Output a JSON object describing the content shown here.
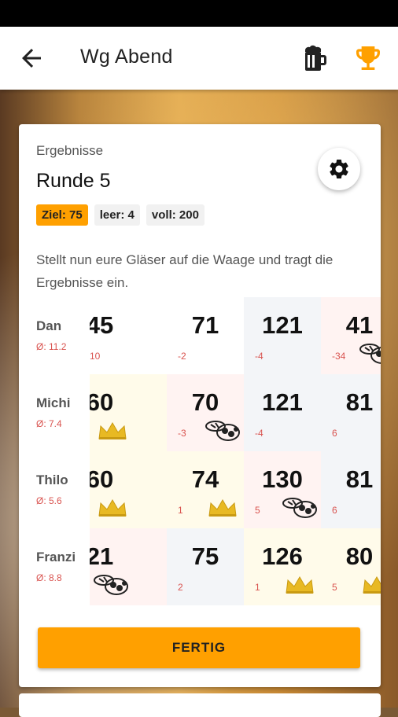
{
  "app": {
    "title": "Wg Abend",
    "icons": {
      "back": "arrow-left-icon",
      "beer": "beer-mug-icon",
      "trophy": "trophy-icon",
      "settings": "gear-icon"
    },
    "colors": {
      "accent": "#ffa000",
      "negative": "#d9534f",
      "underfill_bg": "#fff3f2",
      "exact_bg": "#f1f4f8",
      "win_bg": "#fffbea"
    }
  },
  "card": {
    "label": "Ergebnisse",
    "title": "Runde 5",
    "chips": [
      {
        "label": "Ziel: 75",
        "accent": true
      },
      {
        "label": "leer: 4",
        "accent": false
      },
      {
        "label": "voll: 200",
        "accent": false
      }
    ],
    "instructions": "Stellt nun eure Gläser auf die Waage und tragt die Ergebnisse ein."
  },
  "players": [
    {
      "name": "Dan",
      "avg": "Ø: 11.2",
      "cells": [
        {
          "value": "45",
          "diff": "10",
          "marker": "",
          "bg": "#ffffff"
        },
        {
          "value": "71",
          "diff": "-2",
          "marker": "",
          "bg": "#ffffff"
        },
        {
          "value": "121",
          "diff": "-4",
          "marker": "",
          "bg": "#f3f5f8"
        },
        {
          "value": "41",
          "diff": "-34",
          "marker": "scale",
          "bg": "#fff3f2"
        }
      ]
    },
    {
      "name": "Michi",
      "avg": "Ø: 7.4",
      "cells": [
        {
          "value": "60",
          "diff": "",
          "marker": "crown",
          "bg": "#fffbea"
        },
        {
          "value": "70",
          "diff": "-3",
          "marker": "scale",
          "bg": "#fff3f2"
        },
        {
          "value": "121",
          "diff": "-4",
          "marker": "",
          "bg": "#f3f5f8"
        },
        {
          "value": "81",
          "diff": "6",
          "marker": "",
          "bg": "#f3f5f8"
        }
      ]
    },
    {
      "name": "Thilo",
      "avg": "Ø: 5.6",
      "cells": [
        {
          "value": "60",
          "diff": "",
          "marker": "crown",
          "bg": "#fffbea"
        },
        {
          "value": "74",
          "diff": "1",
          "marker": "crown",
          "bg": "#fffbea"
        },
        {
          "value": "130",
          "diff": "5",
          "marker": "scale",
          "bg": "#fff3f2"
        },
        {
          "value": "81",
          "diff": "6",
          "marker": "",
          "bg": "#f3f5f8"
        }
      ]
    },
    {
      "name": "Franzi",
      "avg": "Ø: 8.8",
      "cells": [
        {
          "value": "21",
          "diff": "",
          "marker": "scale",
          "bg": "#fff3f2"
        },
        {
          "value": "75",
          "diff": "2",
          "marker": "",
          "bg": "#f3f5f8"
        },
        {
          "value": "126",
          "diff": "1",
          "marker": "crown",
          "bg": "#fffbea"
        },
        {
          "value": "80",
          "diff": "5",
          "marker": "crown",
          "bg": "#fffbea"
        }
      ]
    }
  ],
  "done_label": "FERTIG"
}
